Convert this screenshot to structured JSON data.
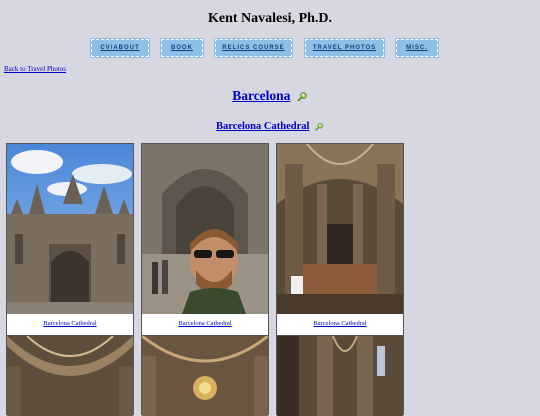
{
  "site": {
    "title": "Kent Navalesi, Ph.D."
  },
  "nav": [
    "CV/ABOUT",
    "BOOK",
    "RELICS COURSE",
    "TRAVEL PHOTOS",
    "MISC."
  ],
  "back_link": "Back to Travel Photos",
  "heading": {
    "city": "Barcelona",
    "place": "Barcelona Cathedral"
  },
  "photos": [
    {
      "caption": "Barcelona Cathedral",
      "subject": "cathedral-facade"
    },
    {
      "caption": "Barcelona Cathedral",
      "subject": "selfie-at-facade"
    },
    {
      "caption": "Barcelona Cathedral",
      "subject": "interior-nave"
    },
    {
      "caption": "",
      "subject": "interior-vault"
    },
    {
      "caption": "",
      "subject": "interior-chandelier"
    },
    {
      "caption": "",
      "subject": "interior-columns"
    }
  ],
  "colors": {
    "background": "#d6d7e0",
    "nav_button": "#8ec0e6",
    "link": "#0000cc"
  }
}
